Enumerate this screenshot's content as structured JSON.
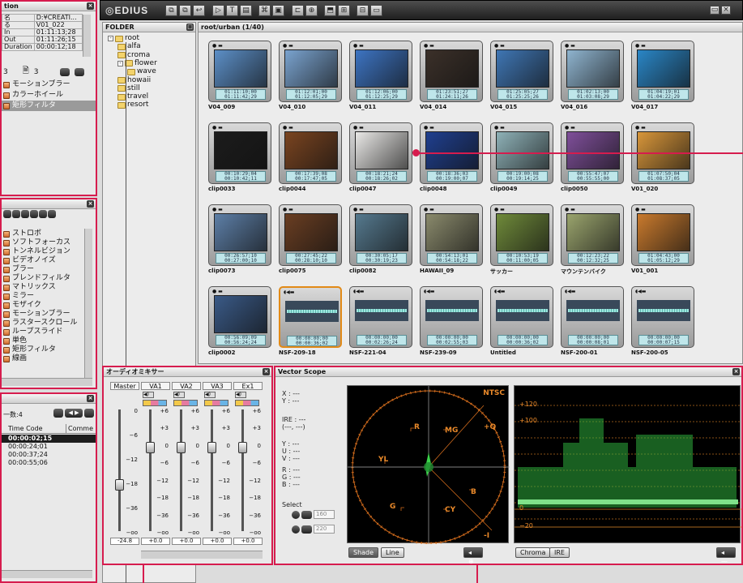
{
  "app": {
    "logo": "EDIUS"
  },
  "left_info": {
    "title": "tion",
    "rows": [
      {
        "k": "名",
        "v": "D:¥CREATI..."
      },
      {
        "k": "る",
        "v": "V01_022"
      },
      {
        "k": "In",
        "v": "01:11:13;28"
      },
      {
        "k": "Out",
        "v": "01:11:26;15"
      },
      {
        "k": "Duration",
        "v": "00:00:12;18"
      }
    ],
    "count_a": "3",
    "count_b": "3",
    "list": [
      "モーションブラー",
      "カラーホイール",
      "矩形フィルタ"
    ],
    "selected_index": 2
  },
  "effects": {
    "items": [
      "ストロボ",
      "ソフトフォーカス",
      "トンネルビジョン",
      "ビデオノイズ",
      "ブラー",
      "ブレンドフィルタ",
      "マトリックス",
      "ミラー",
      "モザイク",
      "モーションブラー",
      "ラスタースクロール",
      "ループスライド",
      "単色",
      "矩形フィルタ",
      "線画"
    ]
  },
  "markers": {
    "title": "一数:4",
    "headers": [
      "Time Code",
      "Comme"
    ],
    "rows": [
      "00:00:02;15",
      "00:00:24;01",
      "00:00:37;24",
      "00:00:55;06"
    ],
    "selected_index": 0
  },
  "folder_panel": {
    "title": "FOLDER",
    "tree": [
      {
        "label": "root",
        "level": 0,
        "expander": "-"
      },
      {
        "label": "alfa",
        "level": 1
      },
      {
        "label": "croma",
        "level": 1
      },
      {
        "label": "flower",
        "level": 1,
        "expander": "-"
      },
      {
        "label": "wave",
        "level": 2
      },
      {
        "label": "howaii",
        "level": 1
      },
      {
        "label": "still",
        "level": 1
      },
      {
        "label": "travel",
        "level": 1
      },
      {
        "label": "resort",
        "level": 1
      }
    ]
  },
  "bin": {
    "path": "root/urban (1/40)",
    "clips": [
      {
        "name": "V04_009",
        "tc_in": "01:11:10;00",
        "tc_out": "01:11:42;29",
        "thumb": "#5c8fc7",
        "kind": "video"
      },
      {
        "name": "V04_010",
        "tc_in": "01:12:01;00",
        "tc_out": "01:12:05;29",
        "thumb": "#7aa3cf",
        "kind": "video"
      },
      {
        "name": "V04_011",
        "tc_in": "01:12:06;00",
        "tc_out": "01:12:25;29",
        "thumb": "#3d74c2",
        "kind": "video"
      },
      {
        "name": "V04_014",
        "tc_in": "01:23:51;27",
        "tc_out": "01:24:11;26",
        "thumb": "#3b3029",
        "kind": "video"
      },
      {
        "name": "V04_015",
        "tc_in": "01:25:05;27",
        "tc_out": "01:25:25;26",
        "thumb": "#3f76b4",
        "kind": "video"
      },
      {
        "name": "V04_016",
        "tc_in": "01:02:13;00",
        "tc_out": "01:03:08;29",
        "thumb": "#8fb4cf",
        "kind": "video"
      },
      {
        "name": "V04_017",
        "tc_in": "01:04:19;01",
        "tc_out": "01:04:22;29",
        "thumb": "#2a86c6",
        "kind": "video"
      },
      {
        "name": "clip0033",
        "tc_in": "00:10:29;04",
        "tc_out": "00:10:42;11",
        "thumb": "#1c1c1c",
        "kind": "video"
      },
      {
        "name": "clip0044",
        "tc_in": "00:17:39;08",
        "tc_out": "00:17:47;05",
        "thumb": "#7a4420",
        "kind": "video"
      },
      {
        "name": "clip0047",
        "tc_in": "00:18:21;24",
        "tc_out": "00:18:26;02",
        "thumb": "#e9e8e6",
        "kind": "video"
      },
      {
        "name": "clip0048",
        "tc_in": "00:18:36;03",
        "tc_out": "00:19:00;07",
        "thumb": "#1f3f8f",
        "kind": "video"
      },
      {
        "name": "clip0049",
        "tc_in": "00:19:00;08",
        "tc_out": "00:19:14;25",
        "thumb": "#8eb1b7",
        "kind": "video"
      },
      {
        "name": "clip0050",
        "tc_in": "00:55:47;07",
        "tc_out": "00:55:55;00",
        "thumb": "#7f4f9a",
        "kind": "video"
      },
      {
        "name": "V01_020",
        "tc_in": "01:07:50;04",
        "tc_out": "01:08:37;05",
        "thumb": "#d8963a",
        "kind": "video"
      },
      {
        "name": "clip0073",
        "tc_in": "00:26:57;10",
        "tc_out": "00:27:00;10",
        "thumb": "#5d7fa7",
        "kind": "video"
      },
      {
        "name": "clip0075",
        "tc_in": "00:27:45;22",
        "tc_out": "00:28:10;10",
        "thumb": "#6a3e22",
        "kind": "video"
      },
      {
        "name": "clip0082",
        "tc_in": "00:30:05;17",
        "tc_out": "00:30:19;23",
        "thumb": "#55798e",
        "kind": "video"
      },
      {
        "name": "HAWAII_09",
        "tc_in": "00:54:13;01",
        "tc_out": "00:54:18;22",
        "thumb": "#8a8a6c",
        "kind": "video"
      },
      {
        "name": "サッカー",
        "tc_in": "00:10:53;19",
        "tc_out": "00:11:00;05",
        "thumb": "#6f8a3a",
        "kind": "video"
      },
      {
        "name": "マウンテンバイク",
        "tc_in": "00:12:23;22",
        "tc_out": "00:12:32;25",
        "thumb": "#9aa46d",
        "kind": "video"
      },
      {
        "name": "V01_001",
        "tc_in": "01:04:43;00",
        "tc_out": "01:05:12;29",
        "thumb": "#c97a2d",
        "kind": "video"
      },
      {
        "name": "clip0002",
        "tc_in": "00:56:09;09",
        "tc_out": "00:56:24;24",
        "thumb": "#3a5a87",
        "kind": "video"
      },
      {
        "name": "NSF-209-18",
        "tc_in": "00:00:00;00",
        "tc_out": "00:00:36;02",
        "thumb": "",
        "kind": "audio",
        "selected": true
      },
      {
        "name": "NSF-221-04",
        "tc_in": "00:00:00;00",
        "tc_out": "00:02:26;24",
        "thumb": "",
        "kind": "audio"
      },
      {
        "name": "NSF-239-09",
        "tc_in": "00:00:00;00",
        "tc_out": "00:02:55;03",
        "thumb": "",
        "kind": "audio"
      },
      {
        "name": "Untitled",
        "tc_in": "00:00:00;00",
        "tc_out": "00:00:36;02",
        "thumb": "",
        "kind": "audio"
      },
      {
        "name": "NSF-200-01",
        "tc_in": "00:00:00;00",
        "tc_out": "00:00:08;01",
        "thumb": "",
        "kind": "audio"
      },
      {
        "name": "NSF-200-05",
        "tc_in": "00:00:00;00",
        "tc_out": "00:00:07;15",
        "thumb": "",
        "kind": "audio"
      }
    ]
  },
  "mixer": {
    "title": "オーディオミキサー",
    "channels": [
      {
        "label": "Master",
        "value": "-24.8",
        "knob": 0.62
      },
      {
        "label": "VA1",
        "value": "+0.0",
        "knob": 0.31
      },
      {
        "label": "VA2",
        "value": "+0.0",
        "knob": 0.31
      },
      {
        "label": "VA3",
        "value": "+0.0",
        "knob": 0.31
      },
      {
        "label": "Ex1",
        "value": "+0.0",
        "knob": 0.31
      }
    ],
    "scale": [
      "+6",
      "+3",
      "0",
      "−6",
      "−12",
      "−18",
      "−36",
      "−oo"
    ],
    "master_scale": [
      "0",
      "−6",
      "−12",
      "−18",
      "−36",
      "−oo"
    ]
  },
  "scope": {
    "title": "Vector Scope",
    "readouts": {
      "xy": [
        "X : ---",
        "Y : ---"
      ],
      "ire": [
        "IRE : ---",
        "(---, ---)"
      ],
      "yuv": [
        "Y : ---",
        "U : ---",
        "V : ---"
      ],
      "rgb": [
        "R : ---",
        "G : ---",
        "B : ---"
      ]
    },
    "select_label": "Select",
    "select_values": [
      "160",
      "220"
    ],
    "standard": "NTSC",
    "vector_labels": [
      "R",
      "MG",
      "+Q",
      "YL",
      "B",
      "G",
      "CY",
      "-I"
    ],
    "wave_labels": [
      "+120",
      "+100",
      "0",
      "−20"
    ],
    "buttons_left": [
      "Shade",
      "Line"
    ],
    "buttons_right": [
      "Chroma",
      "IRE"
    ]
  }
}
